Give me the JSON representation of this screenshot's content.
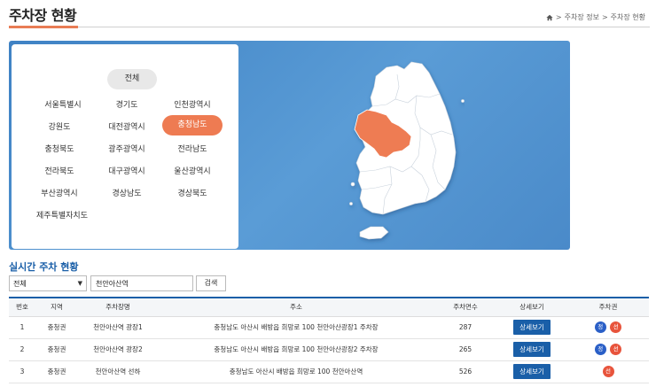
{
  "page": {
    "title": "주차장 현황",
    "breadcrumb": [
      "주차장 정보",
      "주차장 현황"
    ]
  },
  "regions": {
    "all_label": "전체",
    "items": [
      "서울특별시",
      "경기도",
      "인천광역시",
      "강원도",
      "대전광역시",
      "충청남도",
      "충청북도",
      "광주광역시",
      "전라남도",
      "전라북도",
      "대구광역시",
      "울산광역시",
      "부산광역시",
      "경상남도",
      "경상북도",
      "제주특별자치도"
    ],
    "selected": "충청남도"
  },
  "map": {
    "land_color": "#ffffff",
    "highlight_color": "#ee7b52",
    "highlighted_region": "충청남도"
  },
  "realtime": {
    "title": "실시간 주차 현황",
    "filter_value": "전체",
    "search_value": "천안아산역",
    "search_button": "검색"
  },
  "table": {
    "headers": [
      "번호",
      "지역",
      "주차장명",
      "주소",
      "주차면수",
      "상세보기",
      "주차권"
    ],
    "rows": [
      {
        "no": "1",
        "region": "충청권",
        "name": "천안아산역 광장1",
        "address": "충청남도 아산시 배방읍 희망로 100 천안아산광장1 주차장",
        "spaces": "287",
        "detail": "상세보기",
        "passes": [
          "정",
          "선"
        ]
      },
      {
        "no": "2",
        "region": "충청권",
        "name": "천안아산역 광장2",
        "address": "충청남도 아산시 배방읍 희망로 100 천안아산광장2 주차장",
        "spaces": "265",
        "detail": "상세보기",
        "passes": [
          "정",
          "선"
        ]
      },
      {
        "no": "3",
        "region": "충청권",
        "name": "천안아산역 선하",
        "address": "충청남도 아산시 배방읍 희망로 100 천안아산역",
        "spaces": "526",
        "detail": "상세보기",
        "passes": [
          "선"
        ]
      }
    ]
  },
  "colors": {
    "accent": "#1a5fa8",
    "highlight": "#ee7b52",
    "pass_blue": "#2a5fc7",
    "pass_red": "#e8543c"
  }
}
